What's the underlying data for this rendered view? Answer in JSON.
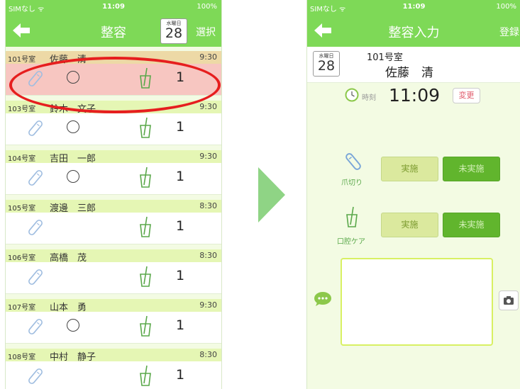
{
  "left_screen": {
    "status": {
      "carrier": "SIMなし ᯤ",
      "time": "11:09",
      "battery": "100%"
    },
    "nav": {
      "title": "整容",
      "right": "選択",
      "date_dow": "水曜日",
      "date_day": "28"
    },
    "rows": [
      {
        "room": "101号室",
        "name": "佐藤　清",
        "time": "9:30",
        "circle": true,
        "count": "1",
        "highlight": true
      },
      {
        "room": "103号室",
        "name": "鈴木　文子",
        "time": "9:30",
        "circle": true,
        "count": "1",
        "highlight": false
      },
      {
        "room": "104号室",
        "name": "吉田　一郎",
        "time": "9:30",
        "circle": true,
        "count": "1",
        "highlight": false
      },
      {
        "room": "105号室",
        "name": "渡邊　三郎",
        "time": "8:30",
        "circle": false,
        "count": "1",
        "highlight": false
      },
      {
        "room": "106号室",
        "name": "高橋　茂",
        "time": "8:30",
        "circle": false,
        "count": "1",
        "highlight": false
      },
      {
        "room": "107号室",
        "name": "山本　勇",
        "time": "9:30",
        "circle": true,
        "count": "1",
        "highlight": false
      },
      {
        "room": "108号室",
        "name": "中村　静子",
        "time": "8:30",
        "circle": false,
        "count": "1",
        "highlight": false
      }
    ]
  },
  "right_screen": {
    "status": {
      "carrier": "SIMなし ᯤ",
      "time": "11:09",
      "battery": "100%"
    },
    "nav": {
      "title": "整容入力",
      "right": "登録"
    },
    "head": {
      "date_dow": "水曜日",
      "date_day": "28",
      "room": "101号室",
      "name": "佐藤　清"
    },
    "time": {
      "label": "時刻",
      "value": "11:09",
      "change": "変更"
    },
    "actions": [
      {
        "label": "爪切り",
        "done": "実施",
        "not_done": "未実施"
      },
      {
        "label": "口腔ケア",
        "done": "実施",
        "not_done": "未実施"
      }
    ]
  },
  "colors": {
    "nav_green": "#7ed957",
    "row_header": "#e5f6b4",
    "highlight": "#e61e1e",
    "arrow": "#8fd485"
  }
}
